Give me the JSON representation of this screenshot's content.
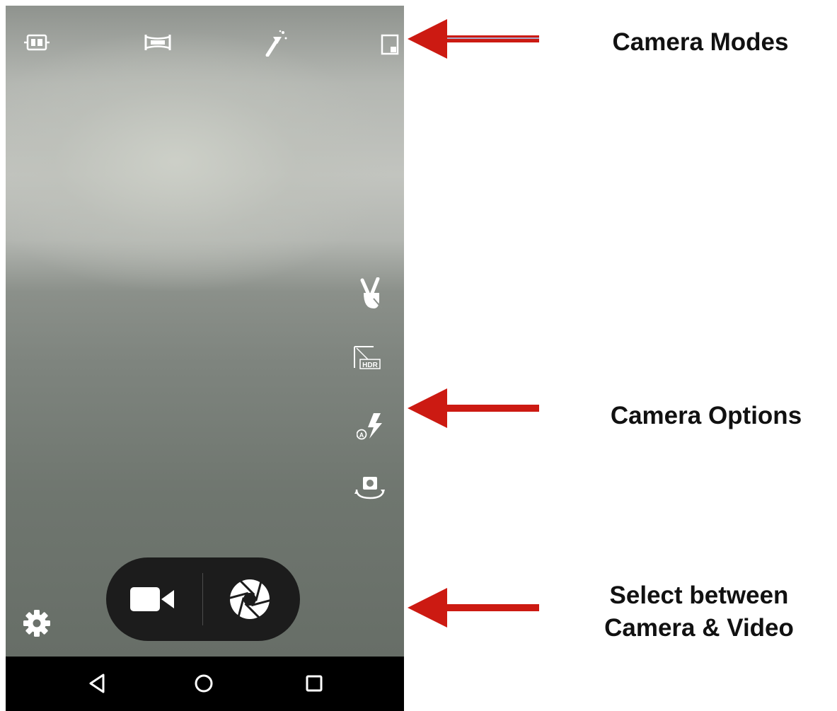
{
  "camera": {
    "modes": [
      {
        "icon": "panorama-mode-icon"
      },
      {
        "icon": "wide-panorama-mode-icon"
      },
      {
        "icon": "magic-wand-effects-icon"
      },
      {
        "icon": "mode-selector-icon"
      }
    ],
    "options": [
      {
        "icon": "gesture-shot-icon"
      },
      {
        "icon": "hdr-icon",
        "text": "HDR"
      },
      {
        "icon": "auto-flash-icon",
        "text": "A"
      },
      {
        "icon": "switch-camera-icon"
      }
    ],
    "settings": {
      "icon": "gear-icon"
    },
    "capture": {
      "video_icon": "video-camera-icon",
      "photo_icon": "shutter-icon"
    }
  },
  "navbar": {
    "back": "back-icon",
    "home": "home-icon",
    "recents": "recents-icon"
  },
  "annotations": {
    "modes": "Camera Modes",
    "options": "Camera Options",
    "select_line1": "Select between",
    "select_line2": "Camera & Video"
  },
  "colors": {
    "arrow": "#cc1a12",
    "pill": "#1c1c1c",
    "icon": "#ffffff"
  }
}
